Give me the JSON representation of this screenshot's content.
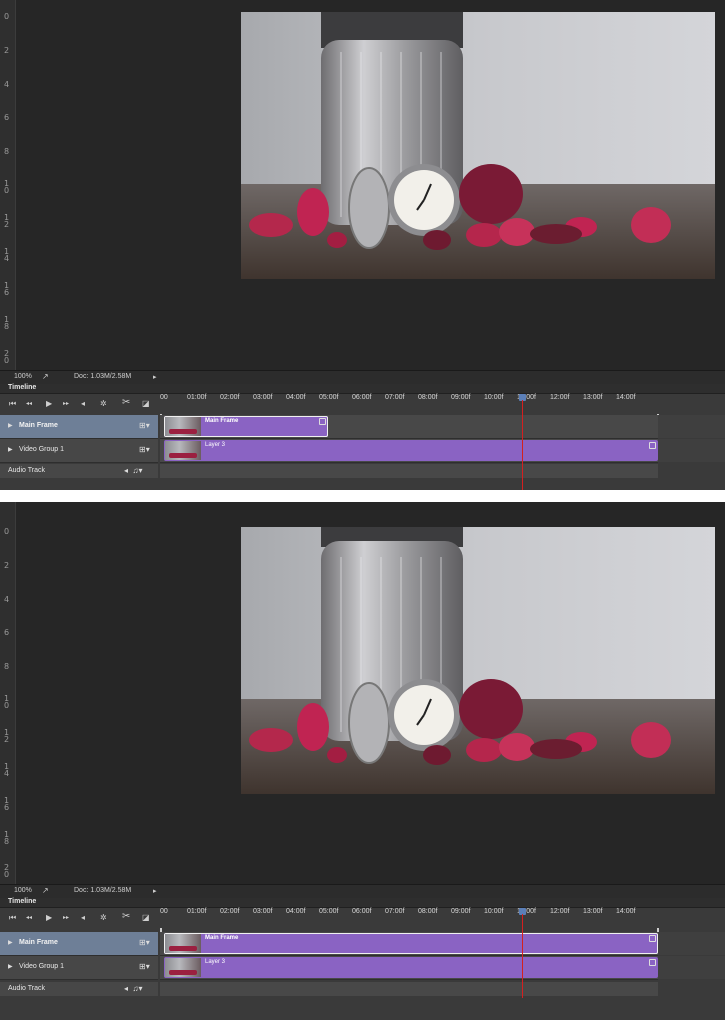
{
  "panels": [
    {
      "ruler_ticks": [
        "0",
        "2",
        "4",
        "6",
        "8",
        "1\n0",
        "1\n2",
        "1\n4",
        "1\n6",
        "1\n8",
        "2\n0"
      ],
      "status": {
        "zoom": "100%",
        "doc": "Doc: 1.03M/2.58M"
      },
      "timeline": {
        "title": "Timeline",
        "ruler": [
          "00",
          "01:00f",
          "02:00f",
          "03:00f",
          "04:00f",
          "05:00f",
          "06:00f",
          "07:00f",
          "08:00f",
          "09:00f",
          "10:00f",
          "11:00f",
          "12:00f",
          "13:00f",
          "14:00f"
        ],
        "tracks": [
          {
            "name": "Main Frame",
            "clip": "Main Frame",
            "clip_end_fraction": 0.33
          },
          {
            "name": "Video Group 1",
            "clip": "Layer 3",
            "clip_end_fraction": 1.0
          }
        ],
        "audio": "Audio Track",
        "playhead_time": "11:00f"
      }
    },
    {
      "ruler_ticks": [
        "0",
        "2",
        "4",
        "6",
        "8",
        "1\n0",
        "1\n2",
        "1\n4",
        "1\n6",
        "1\n8",
        "2\n0"
      ],
      "status": {
        "zoom": "100%",
        "doc": "Doc: 1.03M/2.58M"
      },
      "timeline": {
        "title": "Timeline",
        "ruler": [
          "00",
          "01:00f",
          "02:00f",
          "03:00f",
          "04:00f",
          "05:00f",
          "06:00f",
          "07:00f",
          "08:00f",
          "09:00f",
          "10:00f",
          "11:00f",
          "12:00f",
          "13:00f",
          "14:00f"
        ],
        "tracks": [
          {
            "name": "Main Frame",
            "clip": "Main Frame",
            "clip_end_fraction": 1.0
          },
          {
            "name": "Video Group 1",
            "clip": "Layer 3",
            "clip_end_fraction": 1.0
          }
        ],
        "audio": "Audio Track",
        "playhead_time": "11:00f"
      }
    }
  ],
  "icons": {
    "go_first": "⏮",
    "step_back": "◂◂",
    "play": "▶",
    "step_fwd": "▸▸",
    "audio": "◂",
    "settings": "✲",
    "split": "✂",
    "transition": "◪"
  },
  "colors": {
    "clip": "#8a63c3",
    "selected_track": "#6e7f97",
    "playhead": "#d42020"
  }
}
